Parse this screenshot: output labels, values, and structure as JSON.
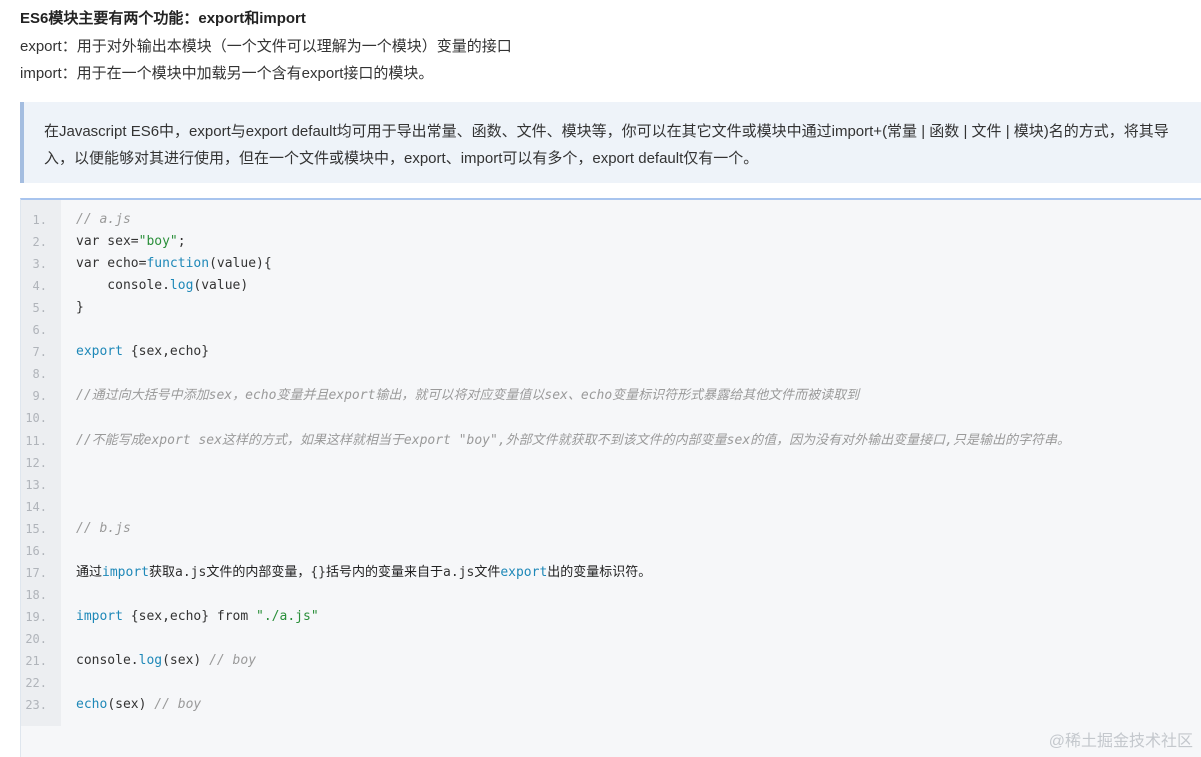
{
  "heading": "ES6模块主要有两个功能：export和import",
  "paragraphs": [
    "export：用于对外输出本模块（一个文件可以理解为一个模块）变量的接口",
    "import：用于在一个模块中加载另一个含有export接口的模块。"
  ],
  "quote": "在Javascript ES6中，export与export default均可用于导出常量、函数、文件、模块等，你可以在其它文件或模块中通过import+(常量 | 函数 | 文件 | 模块)名的方式，将其导入，以便能够对其进行使用，但在一个文件或模块中，export、import可以有多个，export default仅有一个。",
  "code_lines": [
    {
      "n": "1.",
      "parts": [
        [
          "c",
          "// a.js"
        ]
      ]
    },
    {
      "n": "2.",
      "parts": [
        [
          "t",
          "var sex="
        ],
        [
          "s",
          "\"boy\""
        ],
        [
          "t",
          ";"
        ]
      ]
    },
    {
      "n": "3.",
      "parts": [
        [
          "t",
          "var echo="
        ],
        [
          "k",
          "function"
        ],
        [
          "t",
          "(value){"
        ]
      ]
    },
    {
      "n": "4.",
      "parts": [
        [
          "t",
          "    console."
        ],
        [
          "f",
          "log"
        ],
        [
          "t",
          "(value)"
        ]
      ]
    },
    {
      "n": "5.",
      "parts": [
        [
          "t",
          "}"
        ]
      ]
    },
    {
      "n": "6.",
      "parts": []
    },
    {
      "n": "7.",
      "parts": [
        [
          "k",
          "export"
        ],
        [
          "t",
          " {sex,echo}"
        ]
      ]
    },
    {
      "n": "8.",
      "parts": []
    },
    {
      "n": "9.",
      "parts": [
        [
          "c",
          "//通过向大括号中添加sex，echo变量并且export输出，就可以将对应变量值以sex、echo变量标识符形式暴露给其他文件而被读取到"
        ]
      ]
    },
    {
      "n": "10.",
      "parts": []
    },
    {
      "n": "11.",
      "parts": [
        [
          "c",
          "//不能写成export sex这样的方式，如果这样就相当于export \"boy\",外部文件就获取不到该文件的内部变量sex的值，因为没有对外输出变量接口,只是输出的字符串。"
        ]
      ]
    },
    {
      "n": "12.",
      "parts": []
    },
    {
      "n": "13.",
      "parts": []
    },
    {
      "n": "14.",
      "parts": []
    },
    {
      "n": "15.",
      "parts": [
        [
          "c",
          "// b.js"
        ]
      ]
    },
    {
      "n": "16.",
      "parts": []
    },
    {
      "n": "17.",
      "parts": [
        [
          "cn",
          "通过"
        ],
        [
          "k",
          "import"
        ],
        [
          "cn",
          "获取"
        ],
        [
          "t",
          "a.js"
        ],
        [
          "cn",
          "文件的内部变量，"
        ],
        [
          "t",
          "{}"
        ],
        [
          "cn",
          "括号内的变量来自于"
        ],
        [
          "t",
          "a.js"
        ],
        [
          "cn",
          "文件"
        ],
        [
          "k",
          "export"
        ],
        [
          "cn",
          "出的变量标识符。"
        ]
      ]
    },
    {
      "n": "18.",
      "parts": []
    },
    {
      "n": "19.",
      "parts": [
        [
          "k",
          "import"
        ],
        [
          "t",
          " {sex,echo} from "
        ],
        [
          "s",
          "\"./a.js\""
        ]
      ]
    },
    {
      "n": "20.",
      "parts": []
    },
    {
      "n": "21.",
      "parts": [
        [
          "t",
          "console."
        ],
        [
          "f",
          "log"
        ],
        [
          "t",
          "(sex) "
        ],
        [
          "c",
          "// boy"
        ]
      ]
    },
    {
      "n": "22.",
      "parts": []
    },
    {
      "n": "23.",
      "parts": [
        [
          "f",
          "echo"
        ],
        [
          "t",
          "(sex) "
        ],
        [
          "c",
          "// boy"
        ]
      ]
    }
  ],
  "watermark": "@稀土掘金技术社区"
}
